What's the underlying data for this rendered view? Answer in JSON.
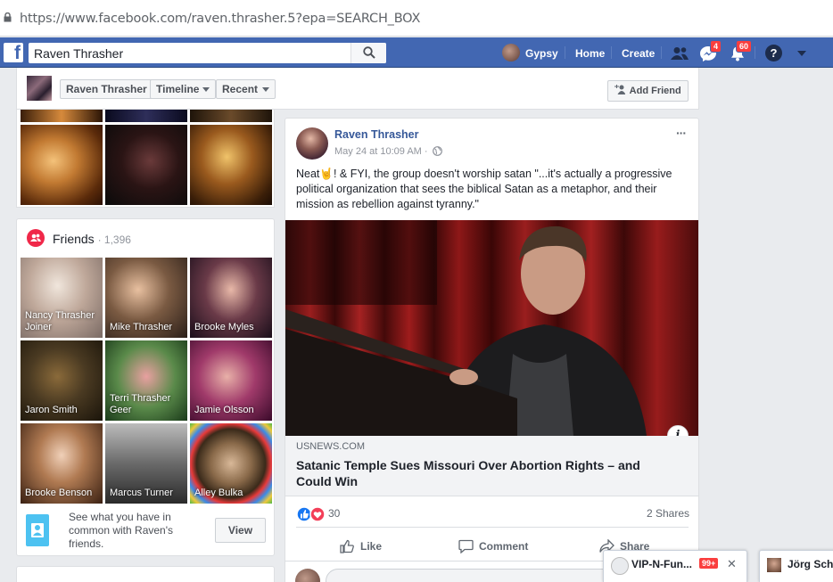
{
  "browser": {
    "url": "https://www.facebook.com/raven.thrasher.5?epa=SEARCH_BOX"
  },
  "topbar": {
    "search_value": "Raven Thrasher",
    "user_name": "Gypsy",
    "home_label": "Home",
    "create_label": "Create",
    "messages_badge": "4",
    "notifications_badge": "60",
    "help_glyph": "?"
  },
  "profile_nav": {
    "name_button": "Raven Thrasher",
    "timeline_button": "Timeline",
    "recent_button": "Recent",
    "add_friend_label": "Add Friend"
  },
  "friends": {
    "title": "Friends",
    "count": "· 1,396",
    "items": [
      {
        "name": "Nancy Thrasher Joiner"
      },
      {
        "name": "Mike Thrasher"
      },
      {
        "name": "Brooke Myles"
      },
      {
        "name": "Jaron Smith"
      },
      {
        "name": "Terri Thrasher Geer"
      },
      {
        "name": "Jamie Olsson"
      },
      {
        "name": "Brooke Benson"
      },
      {
        "name": "Marcus Turner"
      },
      {
        "name": "Alley Bulka"
      }
    ],
    "common_text": "See what you have in common with Raven's friends.",
    "view_label": "View"
  },
  "post": {
    "author": "Raven Thrasher",
    "date": "May 24 at 10:09 AM ·",
    "more_glyph": "···",
    "text": "Neat🤘! & FYI, the group doesn't worship satan \"...it's actually a progressive political organization that sees the biblical Satan as a metaphor, and their mission as rebellion against tyranny.\"",
    "link_source": "USNEWS.COM",
    "link_title": "Satanic Temple Sues Missouri Over Abortion Rights – and Could Win",
    "info_glyph": "i",
    "reactions_count": "30",
    "shares": "2 Shares",
    "like_label": "Like",
    "comment_label": "Comment",
    "share_label": "Share"
  },
  "chat": {
    "tab1_name": "VIP-N-Fun...",
    "tab1_badge": "99+",
    "tab1_close": "✕",
    "tab2_name": "Jörg Schi"
  },
  "colors": {
    "fb_blue": "#4267b2",
    "link_blue": "#365899",
    "badge_red": "#fa3e3e",
    "friends_icon": "#f02849"
  }
}
